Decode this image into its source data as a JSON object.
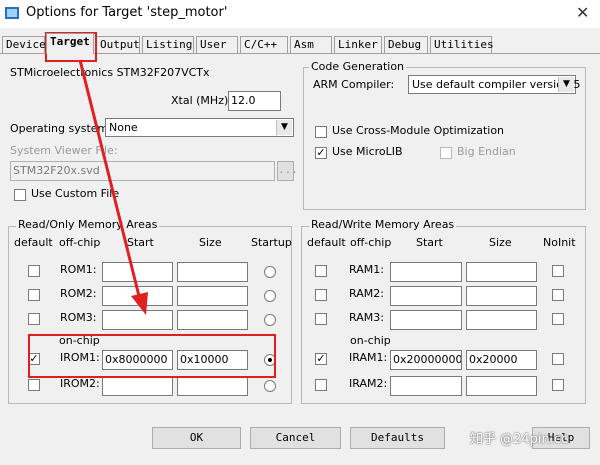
{
  "window": {
    "title": "Options for Target 'step_motor'",
    "close_glyph": "✕"
  },
  "tabs": [
    "Device",
    "Target",
    "Output",
    "Listing",
    "User",
    "C/C++",
    "Asm",
    "Linker",
    "Debug",
    "Utilities"
  ],
  "active_tab": "Target",
  "device": {
    "name": "STMicroelectronics STM32F207VCTx",
    "xtal_label": "Xtal (MHz):",
    "xtal_value": "12.0",
    "os_label": "Operating system:",
    "os_value": "None",
    "svf_label": "System Viewer File:",
    "svf_value": "STM32F20x.svd",
    "svf_browse": "...",
    "custom_file_label": "Use Custom File",
    "custom_file_checked": false
  },
  "codegen": {
    "title": "Code Generation",
    "compiler_label": "ARM Compiler:",
    "compiler_value": "Use default compiler version 5",
    "cross_module_label": "Use Cross-Module Optimization",
    "cross_module_checked": false,
    "microlib_label": "Use MicroLIB",
    "microlib_checked": true,
    "big_endian_label": "Big Endian",
    "big_endian_checked": false
  },
  "rom": {
    "title": "Read/Only Memory Areas",
    "headers": {
      "default": "default",
      "offchip": "off-chip",
      "start": "Start",
      "size": "Size",
      "startup": "Startup"
    },
    "onchip_label": "on-chip",
    "rows": [
      {
        "name": "ROM1:",
        "start": "",
        "size": "",
        "default": false,
        "startup": false
      },
      {
        "name": "ROM2:",
        "start": "",
        "size": "",
        "default": false,
        "startup": false
      },
      {
        "name": "ROM3:",
        "start": "",
        "size": "",
        "default": false,
        "startup": false
      },
      {
        "name": "IROM1:",
        "start": "0x8000000",
        "size": "0x10000",
        "default": true,
        "startup": true
      },
      {
        "name": "IROM2:",
        "start": "",
        "size": "",
        "default": false,
        "startup": false
      }
    ]
  },
  "ram": {
    "title": "Read/Write Memory Areas",
    "headers": {
      "default": "default",
      "offchip": "off-chip",
      "start": "Start",
      "size": "Size",
      "noinit": "NoInit"
    },
    "onchip_label": "on-chip",
    "rows": [
      {
        "name": "RAM1:",
        "start": "",
        "size": "",
        "default": false
      },
      {
        "name": "RAM2:",
        "start": "",
        "size": "",
        "default": false
      },
      {
        "name": "RAM3:",
        "start": "",
        "size": "",
        "default": false
      },
      {
        "name": "IRAM1:",
        "start": "0x20000000",
        "size": "0x20000",
        "default": true
      },
      {
        "name": "IRAM2:",
        "start": "",
        "size": "",
        "default": false
      }
    ]
  },
  "buttons": {
    "ok": "OK",
    "cancel": "Cancel",
    "defaults": "Defaults",
    "help": "Help"
  },
  "watermark": "知乎 @24pin.cc",
  "colors": {
    "annotation_red": "#e02020",
    "background": "#f0f0f0"
  },
  "check_glyph": "✓"
}
